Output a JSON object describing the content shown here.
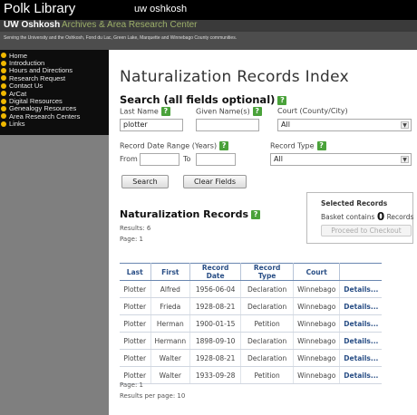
{
  "header": {
    "library": "Polk Library",
    "uw": "uw oshkosh",
    "arc_short": "UW Oshkosh",
    "arc_long": "Archives & Area Research Center",
    "tagline": "Serving the University and the Oshkosh, Fond du Lac, Green Lake, Marquette and Winnebago County communities."
  },
  "sidebar": {
    "items": [
      {
        "label": "Home"
      },
      {
        "label": "Introduction"
      },
      {
        "label": "Hours and Directions"
      },
      {
        "label": "Research Request"
      },
      {
        "label": "Contact Us"
      },
      {
        "label": "ArCat"
      },
      {
        "label": "Digital Resources"
      },
      {
        "label": "Genealogy Resources"
      },
      {
        "label": "Area Research Centers"
      },
      {
        "label": "Links"
      }
    ]
  },
  "main": {
    "title": "Naturalization Records Index",
    "search_heading": "Search (all fields optional)",
    "help_glyph": "?",
    "last_name_label": "Last Name",
    "last_name_value": "plotter",
    "given_name_label": "Given Name(s)",
    "given_name_value": "",
    "court_label": "Court (County/City)",
    "court_value": "All",
    "date_range_label": "Record Date Range (Years)",
    "from_label": "From",
    "to_label": "To",
    "from_value": "",
    "to_value": "",
    "record_type_label": "Record Type",
    "record_type_value": "All",
    "search_button": "Search",
    "clear_button": "Clear Fields",
    "dropdown_arrow": "▼"
  },
  "selected": {
    "heading": "Selected Records",
    "basket_text": "Basket contains",
    "count": "0",
    "records_word": "Records",
    "checkout_button": "Proceed to Checkout"
  },
  "results": {
    "heading": "Naturalization Records",
    "count_text": "Results: 6",
    "page_text": "Page:  1",
    "footer_page": "Page:  1",
    "per_page": "Results per page: 10",
    "columns": [
      "Last",
      "First",
      "Record Date",
      "Record Type",
      "Court",
      ""
    ],
    "rows": [
      [
        "Plotter",
        "Alfred",
        "1956-06-04",
        "Declaration",
        "Winnebago",
        "Details..."
      ],
      [
        "Plotter",
        "Frieda",
        "1928-08-21",
        "Declaration",
        "Winnebago",
        "Details..."
      ],
      [
        "Plotter",
        "Herman",
        "1900-01-15",
        "Petition",
        "Winnebago",
        "Details..."
      ],
      [
        "Plotter",
        "Hermann",
        "1898-09-10",
        "Declaration",
        "Winnebago",
        "Details..."
      ],
      [
        "Plotter",
        "Walter",
        "1928-08-21",
        "Declaration",
        "Winnebago",
        "Details..."
      ],
      [
        "Plotter",
        "Walter",
        "1933-09-28",
        "Petition",
        "Winnebago",
        "Details..."
      ]
    ]
  }
}
